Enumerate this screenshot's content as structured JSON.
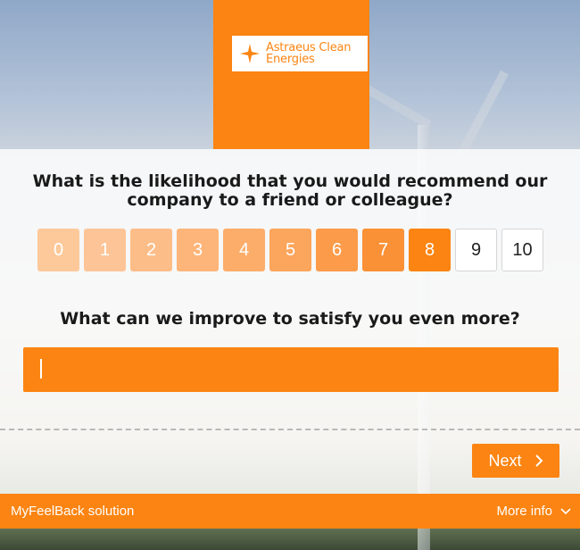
{
  "brand": {
    "name_line1": "Astraeus Clean",
    "name_line2": "Energies",
    "logo_icon": "star-icon",
    "accent_color": "#fb8412"
  },
  "survey": {
    "question_nps": "What is the likelihood that you would recommend our company to a friend or colleague?",
    "scale": [
      {
        "label": "0",
        "color": "#fdc99a"
      },
      {
        "label": "1",
        "color": "#fdc497"
      },
      {
        "label": "2",
        "color": "#fdbd88"
      },
      {
        "label": "3",
        "color": "#fdb57a"
      },
      {
        "label": "4",
        "color": "#fcad6a"
      },
      {
        "label": "5",
        "color": "#fca55c"
      },
      {
        "label": "6",
        "color": "#fc9b49"
      },
      {
        "label": "7",
        "color": "#fb9136"
      },
      {
        "label": "8",
        "color": "#fb8412"
      },
      {
        "label": "9",
        "color": "#ffffff"
      },
      {
        "label": "10",
        "color": "#ffffff"
      }
    ],
    "question_improve": "What can we improve to satisfy you even more?",
    "improve_value": ""
  },
  "actions": {
    "next_label": "Next",
    "next_icon": "chevron-right-icon"
  },
  "footer": {
    "solution_label": "MyFeelBack solution",
    "more_info_label": "More info",
    "more_info_icon": "chevron-down-icon"
  }
}
